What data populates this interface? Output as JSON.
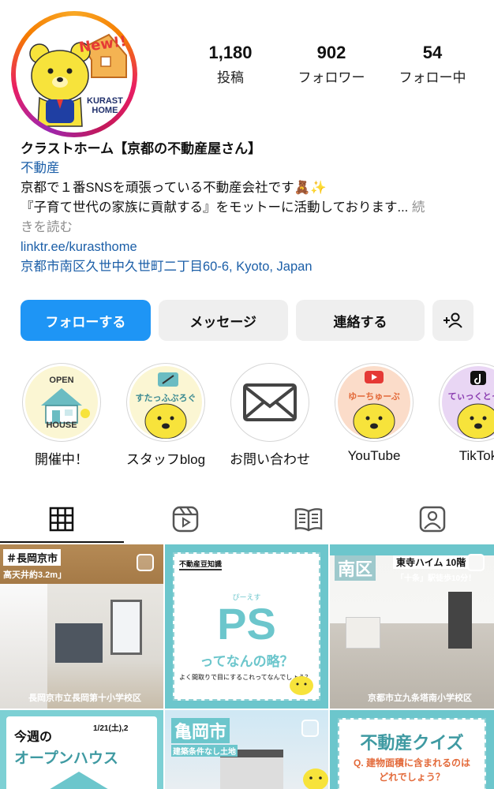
{
  "profile": {
    "avatar_badge": "New!!",
    "avatar_brand_1": "KURAST",
    "avatar_brand_2": "HOME"
  },
  "stats": [
    {
      "value": "1,180",
      "label": "投稿"
    },
    {
      "value": "902",
      "label": "フォロワー"
    },
    {
      "value": "54",
      "label": "フォロー中"
    }
  ],
  "bio": {
    "name": "クラストホーム【京都の不動産屋さん】",
    "category": "不動産",
    "line1": "京都で１番SNSを頑張っている不動産会社です🧸✨",
    "line2": "『子育て世代の家族に貢献する』をモットーに活動しております...",
    "more_1": " 続",
    "more_2": "きを読む",
    "link": "linktr.ee/kurasthome",
    "address": "京都市南区久世中久世町二丁目60-6, Kyoto, Japan"
  },
  "buttons": {
    "follow": "フォローする",
    "message": "メッセージ",
    "contact": "連絡する"
  },
  "highlights": [
    {
      "label": "開催中！",
      "top": "OPEN",
      "bottom": "HOUSE"
    },
    {
      "label": "スタッフblog",
      "caption": "すたっふぶろぐ"
    },
    {
      "label": "お問い合わせ"
    },
    {
      "label": "YouTube",
      "caption": "ゆーちゅーぶ"
    },
    {
      "label": "TikTok",
      "caption": "てぃっくとっく"
    }
  ],
  "posts": {
    "p1": {
      "area": "＃長岡京市",
      "sub": "高天井約3.2m」",
      "footer": "長岡京市立長岡第十小学校区"
    },
    "p2": {
      "header": "不動産豆知識",
      "ruby": "ぴーえす",
      "big": "PS",
      "sub": "ってなんの略？",
      "footer": "よく間取りで目にするこれってなんでしょう？"
    },
    "p3": {
      "area": "南区",
      "name": "東寺ハイム 10階",
      "sub": "「十条」駅徒歩10分！",
      "footer": "京都市立九条塔南小学校区"
    },
    "p4": {
      "head1": "今週の",
      "date": "1/21(土),2",
      "head2": "オープンハウス"
    },
    "p5": {
      "area": "亀岡市",
      "sub": "建築条件なし土地"
    },
    "p6": {
      "title": "不動産クイズ",
      "q": "Q. 建物面積に含まれるのは",
      "q2": "どれでしょう？"
    }
  }
}
